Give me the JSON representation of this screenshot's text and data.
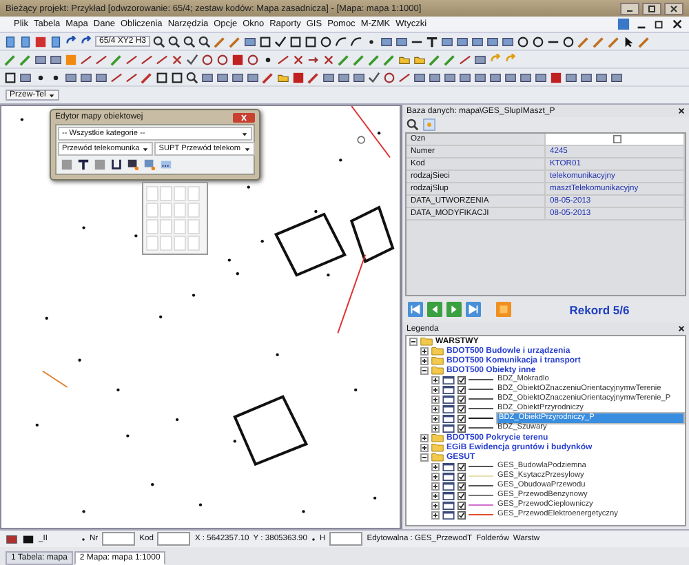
{
  "window": {
    "title": "Bieżący projekt: Przykład [odwzorowanie: 65/4; zestaw kodów: Mapa zasadnicza] - [Mapa: mapa 1:1000]"
  },
  "menu": [
    "Plik",
    "Tabela",
    "Mapa",
    "Dane",
    "Obliczenia",
    "Narzędzia",
    "Opcje",
    "Okno",
    "Raporty",
    "GIS",
    "Pomoc",
    "M-ZMK",
    "Wtyczki"
  ],
  "toolbar": {
    "coords_box": "65/4 XY2 H3",
    "layer_dropdown": "Przew-Tel"
  },
  "editor": {
    "title": "Edytor mapy obiektowej",
    "category": "-- Wszystkie kategorie --",
    "object_type": "Przewód telekomunika",
    "code": "SUPT Przewód telekom"
  },
  "database": {
    "title": "Baza danych: mapa\\GES_SlupIMaszt_P",
    "fields": [
      {
        "kind": "checkbox",
        "name": "Ozn",
        "checked": false
      },
      {
        "kind": "text",
        "name": "Numer",
        "value": "4245"
      },
      {
        "kind": "text",
        "name": "Kod",
        "value": "KTOR01"
      },
      {
        "kind": "text",
        "name": "rodzajSieci",
        "value": "telekomunikacyjny"
      },
      {
        "kind": "text",
        "name": "rodzajSlup",
        "value": "masztTelekomunikacyjny"
      },
      {
        "kind": "text",
        "name": "DATA_UTWORZENIA",
        "value": "08-05-2013"
      },
      {
        "kind": "text",
        "name": "DATA_MODYFIKACJI",
        "value": "08-05-2013"
      }
    ],
    "record": "Rekord 5/6"
  },
  "legend": {
    "title": "Legenda",
    "tree": [
      {
        "kind": "group",
        "label": "WARSTWY",
        "expanded": true,
        "children": [
          {
            "kind": "group",
            "label": "BDOT500 Budowle i urządzenia",
            "expanded": false
          },
          {
            "kind": "group",
            "label": "BDOT500 Komunikacja i transport",
            "expanded": false
          },
          {
            "kind": "group",
            "label": "BDOT500 Obiekty inne",
            "expanded": true,
            "children": [
              {
                "kind": "layer",
                "label": "BDZ_Mokradlo",
                "checked": true,
                "selected": false,
                "color": "#555555"
              },
              {
                "kind": "layer",
                "label": "BDZ_ObiektOZnaczeniuOrientacyjnymwTerenie",
                "checked": true,
                "selected": false,
                "color": "#555555"
              },
              {
                "kind": "layer",
                "label": "BDZ_ObiektOZnaczeniuOrientacyjnymwTerenie_P",
                "checked": true,
                "selected": false,
                "color": "#555555"
              },
              {
                "kind": "layer",
                "label": "BDZ_ObiektPrzyrodniczy",
                "checked": true,
                "selected": false,
                "color": "#555555"
              },
              {
                "kind": "layer",
                "label": "BDZ_ObiektPrzyrodniczy_P",
                "checked": true,
                "selected": true,
                "color": "#222222"
              },
              {
                "kind": "layer",
                "label": "BDZ_Szuwary",
                "checked": true,
                "selected": false,
                "color": "#555555"
              }
            ]
          },
          {
            "kind": "group",
            "label": "BDOT500 Pokrycie terenu",
            "expanded": false
          },
          {
            "kind": "group",
            "label": "EGiB Ewidencja gruntów i budynków",
            "expanded": false
          },
          {
            "kind": "group",
            "label": "GESUT",
            "expanded": true,
            "children": [
              {
                "kind": "layer",
                "label": "GES_BudowlaPodziemna",
                "checked": true,
                "selected": false,
                "color": "#555555"
              },
              {
                "kind": "layer",
                "label": "GES_KsytaczPrzesylowy",
                "checked": true,
                "selected": false,
                "color": "#e8e0b0"
              },
              {
                "kind": "layer",
                "label": "GES_ObudowaPrzewodu",
                "checked": true,
                "selected": false,
                "color": "#555555"
              },
              {
                "kind": "layer",
                "label": "GES_PrzewodBenzynowy",
                "checked": true,
                "selected": false,
                "color": "#777777"
              },
              {
                "kind": "layer",
                "label": "GES_PrzewodCieplowniczy",
                "checked": true,
                "selected": false,
                "color": "#d070d0"
              },
              {
                "kind": "layer",
                "label": "GES_PrzewodElektroenergetyczny",
                "checked": true,
                "selected": false,
                "color": "#e05030"
              }
            ]
          }
        ]
      }
    ]
  },
  "status_bar": {
    "layer": "_II",
    "nr_label": "Nr",
    "kod_label": "Kod",
    "x": "X : 5642357.10",
    "y": "Y : 3805363.90",
    "h_label": "H",
    "editable": "Edytowalna : GES_PrzewodT",
    "folders": "Folderów",
    "layers": "Warstw"
  },
  "tabs": [
    {
      "label": "1 Tabela: mapa",
      "selected": false
    },
    {
      "label": "2 Mapa: mapa 1:1000",
      "selected": true
    }
  ]
}
